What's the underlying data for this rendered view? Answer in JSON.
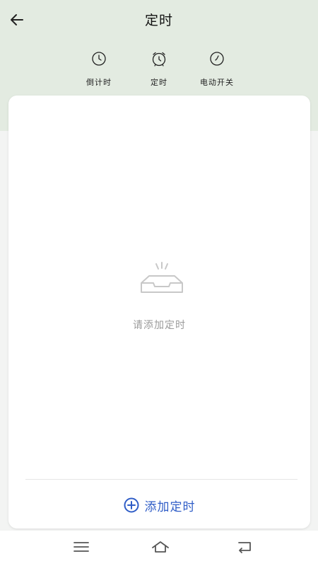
{
  "header": {
    "title": "定时"
  },
  "modes": [
    {
      "label": "倒计时",
      "icon": "clock-icon"
    },
    {
      "label": "定时",
      "icon": "alarm-clock-icon"
    },
    {
      "label": "电动开关",
      "icon": "clock-icon"
    }
  ],
  "empty_state": {
    "message": "请添加定时",
    "icon": "empty-inbox-icon"
  },
  "add_button": {
    "label": "添加定时",
    "icon": "plus-circle-icon"
  },
  "nav": [
    {
      "icon": "menu-icon"
    },
    {
      "icon": "home-icon"
    },
    {
      "icon": "back-icon"
    }
  ],
  "colors": {
    "header_bg": "#e3ebe1",
    "accent": "#2f5dc7"
  }
}
